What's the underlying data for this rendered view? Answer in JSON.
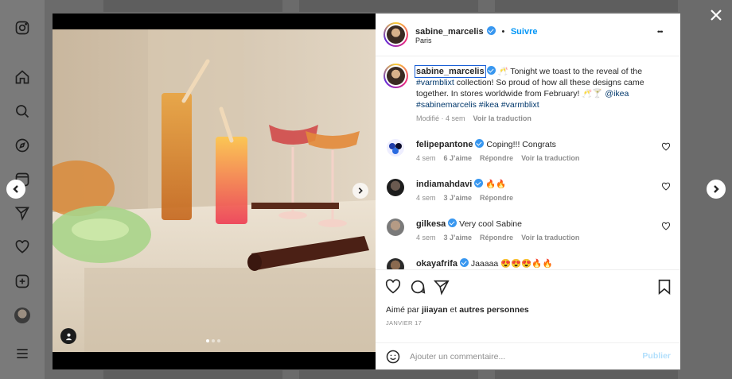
{
  "post": {
    "username": "sabine_marcelis",
    "follow_label": "Suivre",
    "separator": "•",
    "location": "Paris",
    "more_label": "•••",
    "caption_user": "sabine_marcelis",
    "caption_part1": "🥂 Tonight we toast to the reveal of the ",
    "caption_tag1": "#varmblixt",
    "caption_part2": " collection! So proud of how all these designs came together. In stores worldwide from February! 🥂🍸 ",
    "caption_mention": "@ikea",
    "caption_tags2": "#sabinemarcelis #ikea #varmblixt",
    "caption_modified": "Modifié · 4 sem",
    "translate_label": "Voir la traduction"
  },
  "comments": [
    {
      "user": "felipepantone",
      "text": "Coping!!! Congrats",
      "age": "4 sem",
      "likes": "6 J’aime",
      "reply": "Répondre",
      "translate": "Voir la traduction"
    },
    {
      "user": "indiamahdavi",
      "text": "🔥🔥",
      "age": "4 sem",
      "likes": "3 J’aime",
      "reply": "Répondre",
      "translate": ""
    },
    {
      "user": "gilkesa",
      "text": "Very cool Sabine",
      "age": "4 sem",
      "likes": "3 J’aime",
      "reply": "Répondre",
      "translate": "Voir la traduction"
    },
    {
      "user": "okayafrifa",
      "text": "Jaaaaa 😍😍😍🔥🔥",
      "age": "",
      "likes": "",
      "reply": "",
      "translate": ""
    }
  ],
  "footer": {
    "liked_prefix": "Aimé par ",
    "liked_user": "jiiayan",
    "liked_and": " et ",
    "liked_others": "autres personnes",
    "date": "JANVIER 17",
    "comment_placeholder": "Ajouter un commentaire...",
    "post_label": "Publier"
  },
  "carousel": {
    "current": 1,
    "total": 3
  },
  "icons": {
    "nav": [
      "instagram-icon",
      "home-icon",
      "search-icon",
      "explore-icon",
      "reels-icon",
      "direct-icon",
      "heart-icon",
      "create-icon",
      "profile-avatar",
      "menu-icon"
    ],
    "actions": [
      "heart-icon",
      "comment-icon",
      "share-icon",
      "bookmark-icon"
    ]
  },
  "colors": {
    "accent": "#0095f6",
    "verified": "#3897f0",
    "overlay": "#6b6b6b"
  }
}
